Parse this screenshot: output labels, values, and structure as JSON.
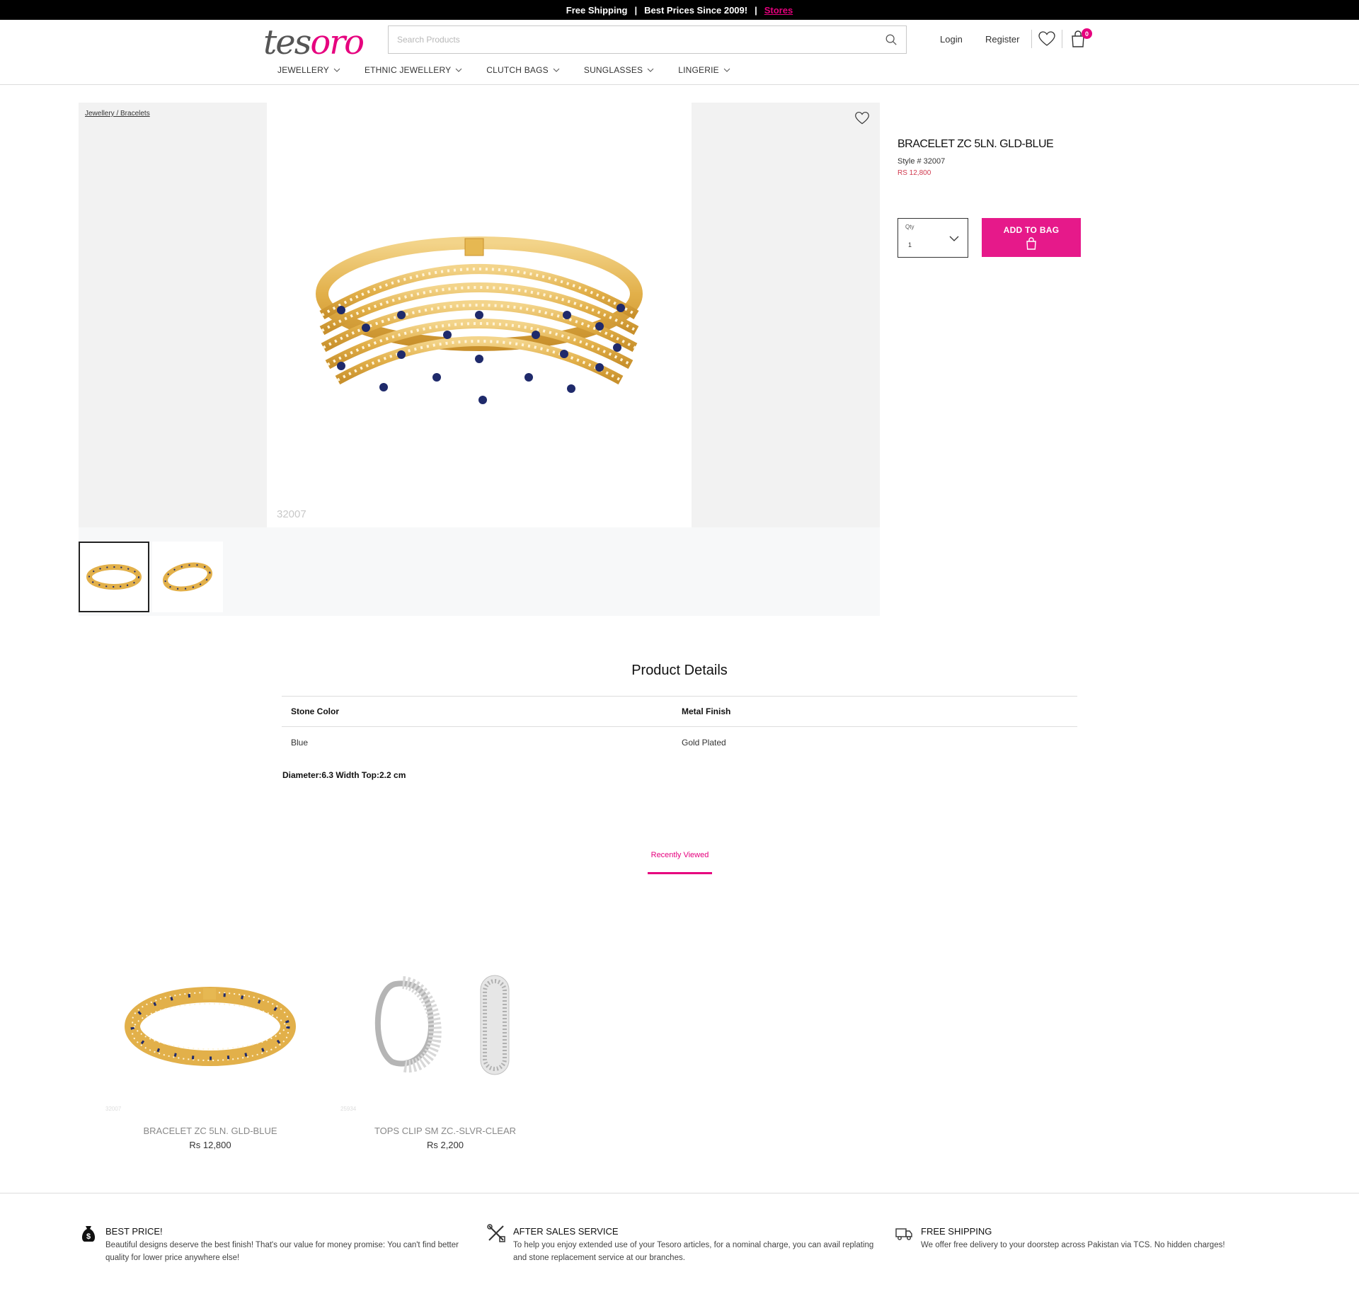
{
  "promo": {
    "shipping": "Free Shipping",
    "separator": "|",
    "prices": "Best Prices Since 2009!",
    "stores": "Stores"
  },
  "header": {
    "logo_part1": "tes",
    "logo_part2": "oro",
    "search_placeholder": "Search Products",
    "login": "Login",
    "register": "Register",
    "cart_count": "0"
  },
  "nav": {
    "items": [
      "JEWELLERY",
      "ETHNIC JEWELLERY",
      "CLUTCH BAGS",
      "SUNGLASSES",
      "LINGERIE"
    ]
  },
  "product": {
    "breadcrumb": "Jewellery / Bracelets",
    "style_watermark": "32007",
    "name": "BRACELET ZC 5LN. GLD-BLUE",
    "style": "Style # 32007",
    "price": "RS 12,800",
    "qty_label": "Qty",
    "qty_value": "1",
    "add_to_bag": "ADD TO BAG"
  },
  "details": {
    "title": "Product Details",
    "headers": [
      "Stone Color",
      "Metal Finish"
    ],
    "values": [
      "Blue",
      "Gold Plated"
    ],
    "note": "Diameter:6.3 Width Top:2.2 cm"
  },
  "recently_viewed": {
    "tab": "Recently Viewed",
    "items": [
      {
        "sku": "32007",
        "name": "BRACELET ZC 5LN. GLD-BLUE",
        "price": "Rs 12,800"
      },
      {
        "sku": "25934",
        "name": "TOPS CLIP SM ZC.-SLVR-CLEAR",
        "price": "Rs 2,200"
      }
    ]
  },
  "features": [
    {
      "icon": "money-bag-icon",
      "title": "BEST PRICE!",
      "desc": "Beautiful designs deserve the best finish! That's our value for money promise: You can't find better quality for lower price anywhere else!"
    },
    {
      "icon": "tools-icon",
      "title": "AFTER SALES SERVICE",
      "desc": "To help you enjoy extended use of your Tesoro articles, for a nominal charge, you can avail replating and stone replacement service at our branches."
    },
    {
      "icon": "delivery-truck-icon",
      "title": "FREE SHIPPING",
      "desc": "We offer free delivery to your doorstep across Pakistan via TCS. No hidden charges!"
    }
  ],
  "colors": {
    "accent": "#e6007e",
    "button": "#e6198a",
    "price": "#d0394e",
    "gold": "#e2b04a",
    "stone_blue": "#1f2a6b"
  }
}
